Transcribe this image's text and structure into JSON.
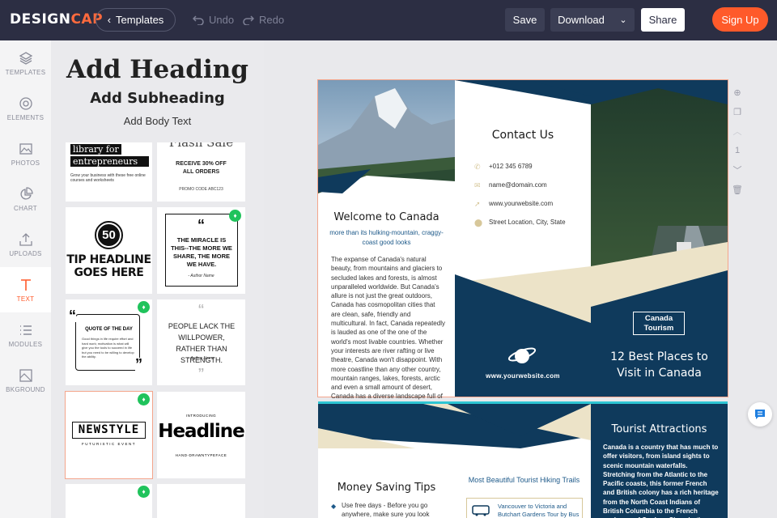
{
  "topbar": {
    "logo_a": "DESIGN",
    "logo_b": "CAP",
    "templates": "Templates",
    "undo": "Undo",
    "redo": "Redo",
    "save": "Save",
    "download": "Download",
    "share": "Share",
    "signup": "Sign Up"
  },
  "sidebar": {
    "items": [
      {
        "label": "TEMPLATES",
        "icon": "layers-icon"
      },
      {
        "label": "ELEMENTS",
        "icon": "elements-icon"
      },
      {
        "label": "PHOTOS",
        "icon": "image-icon"
      },
      {
        "label": "CHART",
        "icon": "pie-chart-icon"
      },
      {
        "label": "UPLOADS",
        "icon": "upload-icon"
      },
      {
        "label": "TEXT",
        "icon": "text-icon"
      },
      {
        "label": "MODULES",
        "icon": "list-icon"
      },
      {
        "label": "BKGROUND",
        "icon": "background-icon"
      }
    ]
  },
  "panel": {
    "add_heading": "Add Heading",
    "add_subheading": "Add Subheading",
    "add_body": "Add Body Text",
    "templates": {
      "t1_line1": "library for",
      "t1_line2": "entrepreneurs",
      "t1_body": "Grow your business with these free online courses and worksheets",
      "t2_top": "Flash Sale",
      "t2_line1": "RECEIVE 30% OFF",
      "t2_line2": "ALL ORDERS",
      "t2_code": "PROMO CODE ABC123",
      "t3_num": "50",
      "t3_line1": "TIP HEADLINE",
      "t3_line2": "GOES HERE",
      "t4_quote": "THE MIRACLE IS THIS--THE MORE WE SHARE, THE MORE WE HAVE.",
      "t4_author": "- Author Name",
      "t5_title": "QUOTE OF THE DAY",
      "t5_body": "Good things in life require effort and hard work; motivation is what will give you the tools to succeed in life but you need to be willing to develop the ability.",
      "t6_quote": "PEOPLE LACK THE WILLPOWER, RATHER THAN STRENGTH.",
      "t6_author": "- Author Name",
      "t7_title": "NEWSTYLE",
      "t7_sub": "FUTURISTIC EVENT",
      "t8_intro": "INTRODUCING",
      "t8_title": "Headline",
      "t8_sub": "HAND-DRAWNTYPEFACE"
    }
  },
  "brochure": {
    "welcome_title": "Welcome to Canada",
    "welcome_sub": "more than its hulking-mountain, craggy-coast good looks",
    "welcome_body": "The expanse of Canada's natural beauty, from mountains and glaciers to secluded lakes and forests, is almost unparalleled worldwide. But Canada's allure is not just the great outdoors, Canada has cosmopolitan cities that are clean, safe, friendly and multicultural. In fact, Canada repeatedly is lauded as one of the one of the world's most livable countries. Whether your interests are river rafting or live theatre, Canada won't disappoint. With more coastline than any other country, mountain ranges, lakes, forests, arctic and even a small amount of desert, Canada has a diverse landscape full of surprises.",
    "contact_title": "Contact Us",
    "phone": "+012 345 6789",
    "email": "name@domain.com",
    "website": "www.yourwebsite.com",
    "address": "Street Location, City, State",
    "footer_url": "www.yourwebsite.com",
    "canada_l1": "Canada",
    "canada_l2": "Tourism",
    "places_l1": "12 Best Places to",
    "places_l2": "Visit in Canada",
    "money_title": "Money Saving Tips",
    "tip1": "Use free days - Before you go anywhere, make sure you look on",
    "hiking_title": "Most Beautiful Tourist Hiking Trails",
    "hiking_item": "Vancouver to Victoria and Butchart Gardens Tour by Bus",
    "attractions_title": "Tourist Attractions",
    "attractions_body": "Canada is a country that has much to offer visitors, from island sights to scenic mountain waterfalls. Stretching from the Atlantic to the Pacific coasts, this former French and British colony has a rich heritage from the North Coast Indians of British Columbia to the French explorers of Quebec. Since both French and English are the national languages, a visit to"
  },
  "page_tools": {
    "page_number": "1"
  },
  "colors": {
    "navy": "#0f3a5c",
    "cream": "#ece3c8",
    "accent": "#ff5a2a",
    "topbar": "#2c2e43"
  }
}
